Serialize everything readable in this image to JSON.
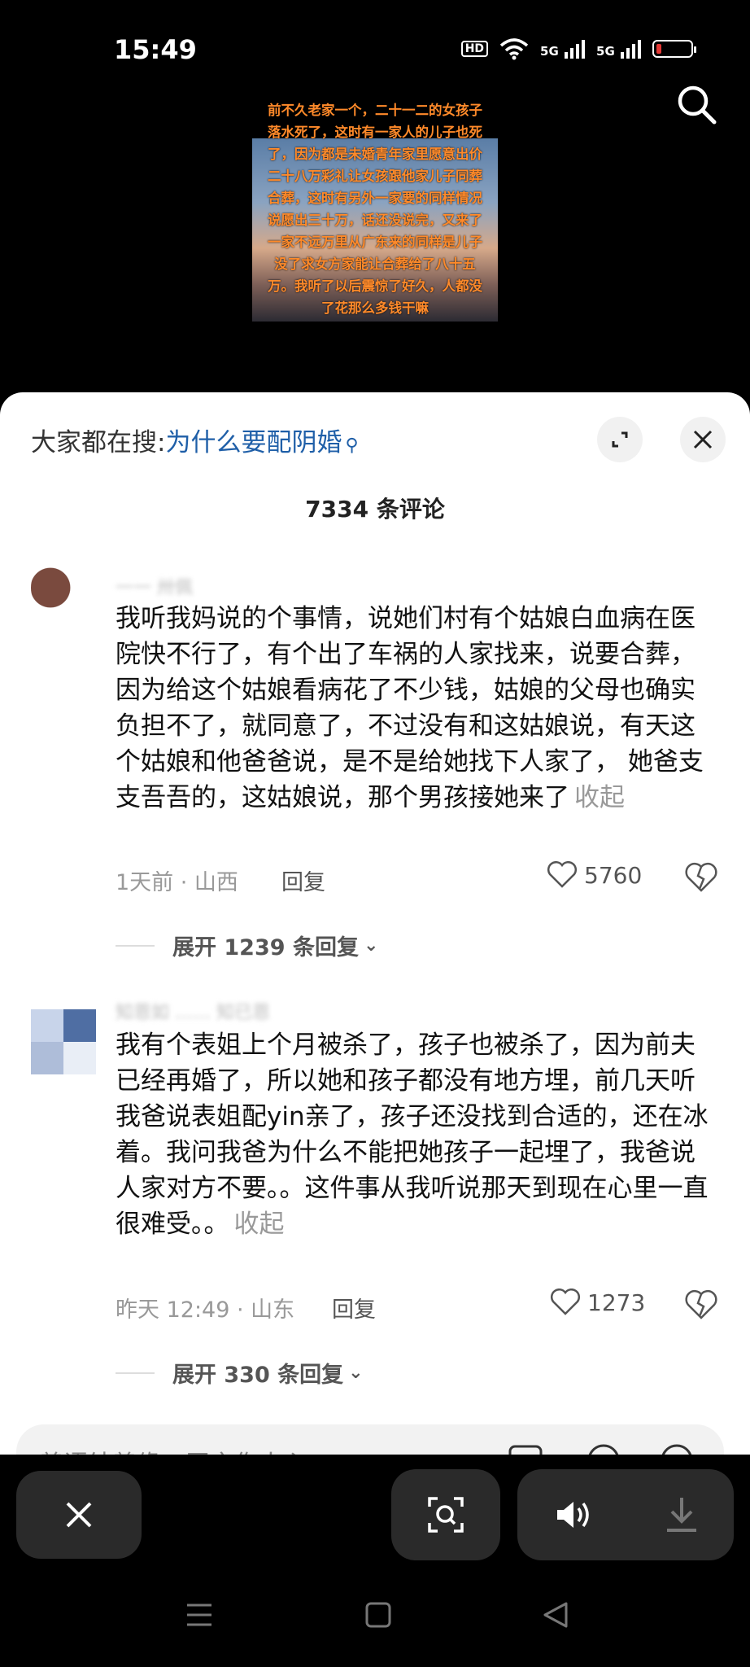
{
  "status": {
    "time": "15:49",
    "hd": "HD",
    "sig1": "5G",
    "sig2": "5G"
  },
  "video": {
    "overlay_text": "前不久老家一个，二十一二的女孩子落水死了，这时有一家人的儿子也死了，因为都是未婚青年家里愿意出价二十八万彩礼让女孩跟他家儿子同葬合葬，这时有另外一家要的同样情况说愿出三十万，话还没说完，又来了一家不远万里从广东来的同样是儿子没了求女方家能让合葬给了八十五万。我听了以后震惊了好久，人都没了花那么多钱干嘛"
  },
  "sheet": {
    "search_prefix": "大家都在搜:",
    "search_query": "为什么要配阴婚",
    "comment_count": "7334 条评论",
    "comments": [
      {
        "name": "一一 卅佩",
        "text": "我听我妈说的个事情，说她们村有个姑娘白血病在医院快不行了，有个出了车祸的人家找来，说要合葬，因为给这个姑娘看病花了不少钱，姑娘的父母也确实负担不了，就同意了，不过没有和这姑娘说，有天这个姑娘和他爸爸说，是不是给她找下人家了， 她爸支支吾吾的，这姑娘说，那个男孩接她来了",
        "collapse": "收起",
        "meta": "1天前 · 山西",
        "reply": "回复",
        "likes": "5760",
        "expand": "展开 1239 条回复"
      },
      {
        "name": "知恩如 …… 知已恩",
        "text": "我有个表姐上个月被杀了，孩子也被杀了，因为前夫已经再婚了，所以她和孩子都没有地方埋，前几天听我爸说表姐配yin亲了，孩子还没找到合适的，还在冰着。我问我爸为什么不能把她孩子一起埋了，我爸说人家对方不要。。这件事从我听说那天到现在心里一直很难受。。",
        "collapse": "收起",
        "meta": "昨天 12:49 · 山东",
        "reply": "回复",
        "likes": "1273",
        "expand": "展开 330 条回复"
      }
    ],
    "input_placeholder": "善语结善缘，恶言伤人心"
  }
}
